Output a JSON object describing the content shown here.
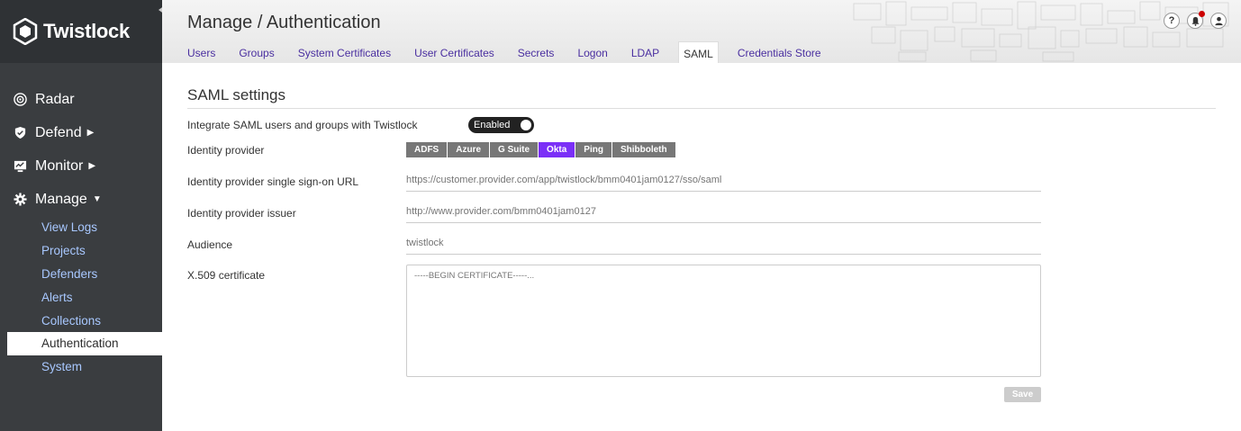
{
  "brand": {
    "name": "Twistlock"
  },
  "sidebar": {
    "items": [
      {
        "label": "Radar",
        "icon": "radar-icon"
      },
      {
        "label": "Defend",
        "icon": "shield-icon"
      },
      {
        "label": "Monitor",
        "icon": "monitor-icon"
      },
      {
        "label": "Manage",
        "icon": "gear-icon"
      }
    ],
    "sub_items": [
      "View Logs",
      "Projects",
      "Defenders",
      "Alerts",
      "Collections",
      "Authentication",
      "System"
    ]
  },
  "header": {
    "title": "Manage / Authentication",
    "tabs": [
      "Users",
      "Groups",
      "System Certificates",
      "User Certificates",
      "Secrets",
      "Logon",
      "LDAP",
      "SAML",
      "Credentials Store"
    ],
    "active_tab": "SAML"
  },
  "main": {
    "section_title": "SAML settings",
    "integrate_label": "Integrate SAML users and groups with Twistlock",
    "toggle_label": "Enabled",
    "idp_label": "Identity provider",
    "idp_options": [
      "ADFS",
      "Azure",
      "G Suite",
      "Okta",
      "Ping",
      "Shibboleth"
    ],
    "idp_selected": "Okta",
    "sso_url_label": "Identity provider single sign-on URL",
    "sso_url_placeholder": "https://customer.provider.com/app/twistlock/bmm0401jam0127/sso/saml",
    "issuer_label": "Identity provider issuer",
    "issuer_placeholder": "http://www.provider.com/bmm0401jam0127",
    "audience_label": "Audience",
    "audience_placeholder": "twistlock",
    "cert_label": "X.509 certificate",
    "cert_placeholder": "-----BEGIN CERTIFICATE-----...",
    "save_label": "Save"
  },
  "colors": {
    "accent": "#7b2ff7",
    "sidebar": "#3a3d40",
    "link": "#a8c8ff",
    "alert_dot": "#cc0000"
  }
}
